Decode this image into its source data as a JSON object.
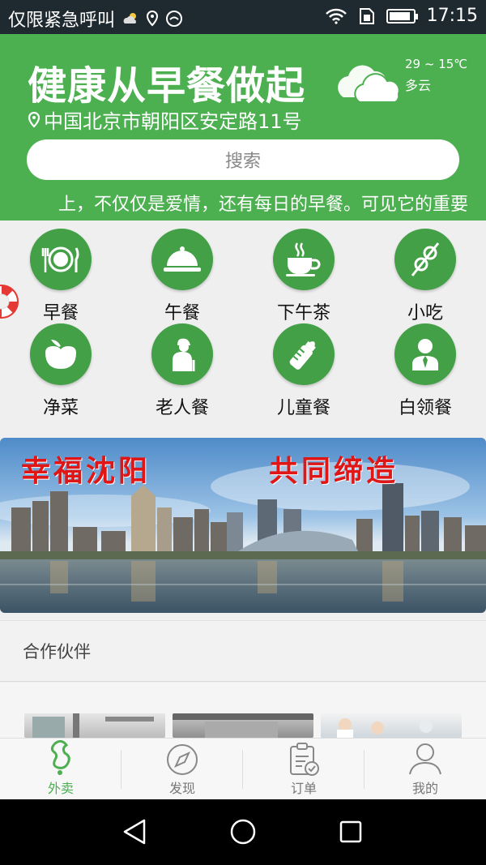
{
  "status_bar": {
    "carrier": "仅限紧急呼叫",
    "time": "17:15"
  },
  "header": {
    "title": "健康从早餐做起",
    "location": "中国北京市朝阳区安定路11号",
    "weather": {
      "temperature": "29 ~ 15℃",
      "condition": "多云"
    },
    "search_placeholder": "搜索",
    "marquee": "上，不仅仅是爱情，还有每日的早餐。可见它的重要"
  },
  "categories": [
    {
      "label": "早餐",
      "icon": "plate-cutlery-icon"
    },
    {
      "label": "午餐",
      "icon": "cloche-icon"
    },
    {
      "label": "下午茶",
      "icon": "coffee-cup-icon"
    },
    {
      "label": "小吃",
      "icon": "skewer-icon"
    },
    {
      "label": "净菜",
      "icon": "vegetable-icon"
    },
    {
      "label": "老人餐",
      "icon": "elderly-icon"
    },
    {
      "label": "儿童餐",
      "icon": "baby-bottle-icon"
    },
    {
      "label": "白领餐",
      "icon": "office-worker-icon"
    }
  ],
  "banner": {
    "text_left": "幸福沈阳",
    "text_right": "共同缔造"
  },
  "partners": {
    "title": "合作伙伴"
  },
  "tabs": [
    {
      "label": "外卖",
      "icon": "takeout-icon",
      "active": true
    },
    {
      "label": "发现",
      "icon": "compass-icon",
      "active": false
    },
    {
      "label": "订单",
      "icon": "clipboard-icon",
      "active": false
    },
    {
      "label": "我的",
      "icon": "user-icon",
      "active": false
    }
  ],
  "colors": {
    "brand_green": "#4caf50",
    "status_bar": "#1f2a30"
  }
}
